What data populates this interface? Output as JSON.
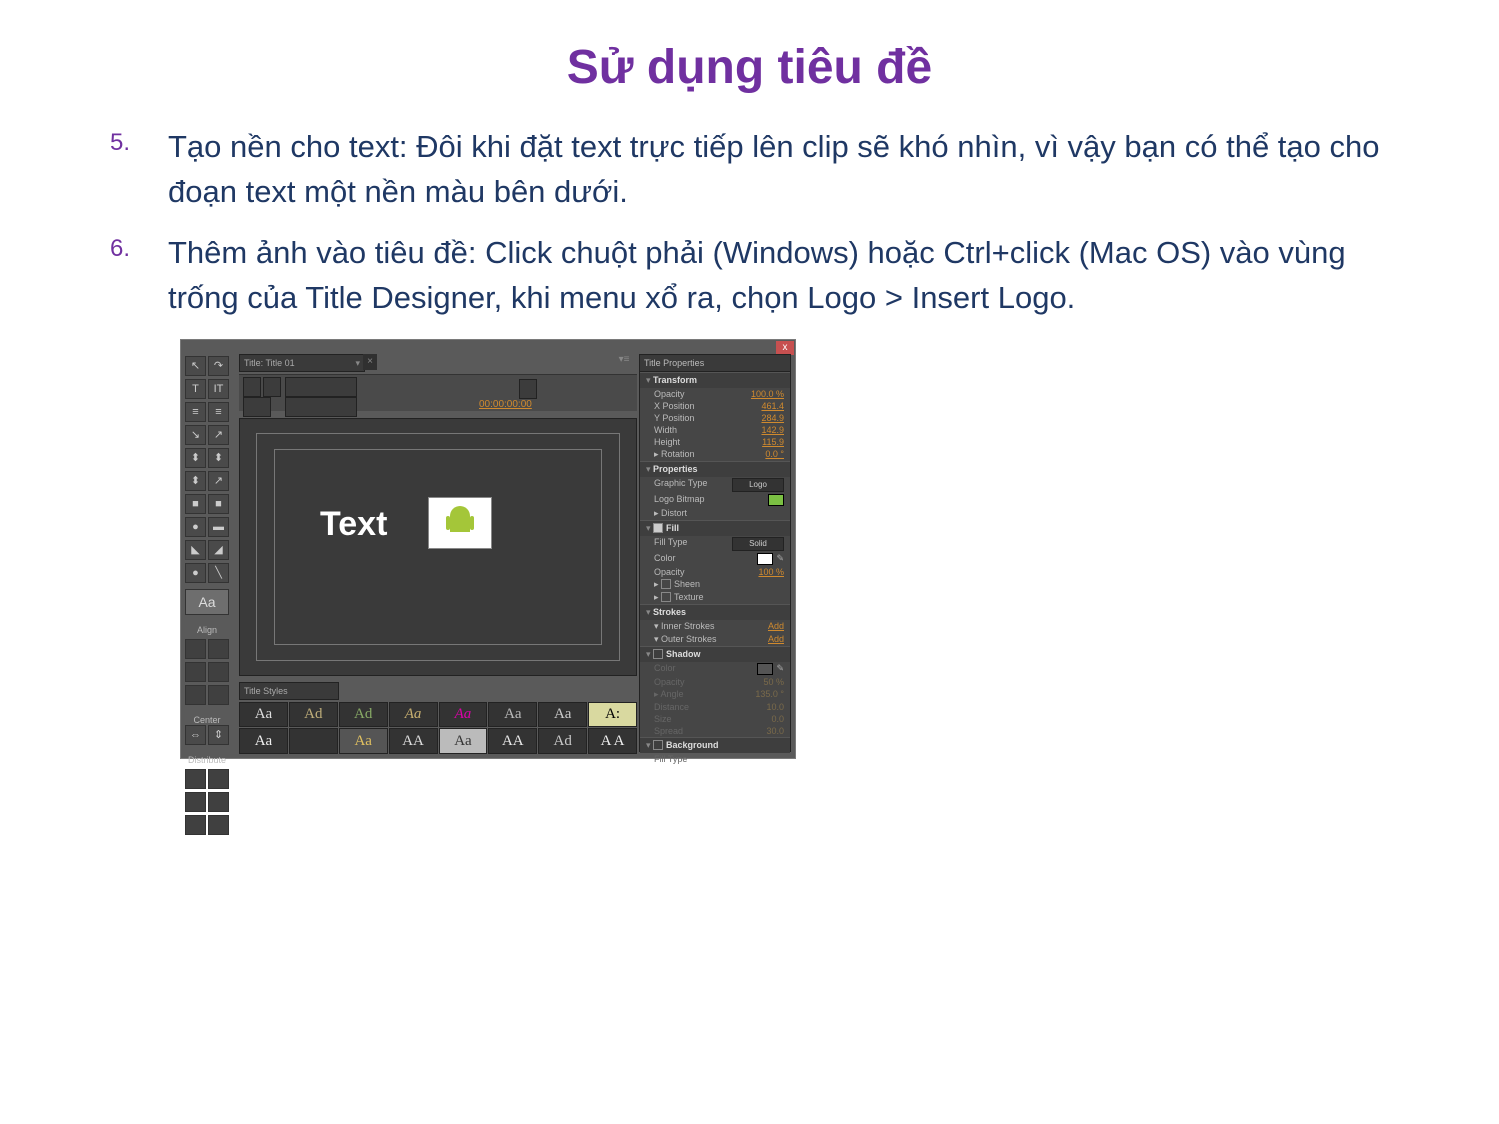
{
  "title": "Sử dụng tiêu đề",
  "items": [
    {
      "num": "5.",
      "text": "Tạo nền cho text: Đôi khi đặt text trực tiếp lên clip sẽ khó nhìn, vì vậy bạn có thể tạo cho đoạn text một nền màu bên dưới."
    },
    {
      "num": "6.",
      "text": "Thêm ảnh vào tiêu đề: Click chuột phải (Windows) hoặc Ctrl+click (Mac OS) vào vùng trống của Title Designer, khi menu xổ ra, chọn Logo > Insert Logo."
    }
  ],
  "editor": {
    "close": "x",
    "tab": "Title: Title 01",
    "timecode": "00:00:00:00",
    "canvas_text": "Text",
    "tools_glyphs": [
      [
        "↖",
        "↷"
      ],
      [
        "T",
        "IT"
      ],
      [
        "≡",
        "≡"
      ],
      [
        "↘",
        "↗"
      ],
      [
        "⬍",
        "⬍"
      ],
      [
        "⬍",
        "↗"
      ],
      [
        "■",
        "■"
      ],
      [
        "●",
        "▬"
      ],
      [
        "◣",
        "◢"
      ],
      [
        "●",
        "╲"
      ]
    ],
    "aa": "Aa",
    "labels": {
      "align": "Align",
      "center": "Center",
      "distribute": "Distribute"
    },
    "center_glyphs": [
      "⇔",
      "⇕"
    ],
    "styles_tab": "Title Styles",
    "style_cells": [
      {
        "t": "Aa",
        "c": "#ddd"
      },
      {
        "t": "Ad",
        "c": "#bfae7a"
      },
      {
        "t": "Ad",
        "c": "#8a6"
      },
      {
        "t": "Aa",
        "c": "#c8b070",
        "i": true
      },
      {
        "t": "Aa",
        "c": "#d0a",
        "i": true
      },
      {
        "t": "Aa",
        "c": "#bbb"
      },
      {
        "t": "Aa",
        "c": "#ccc"
      },
      {
        "t": "A:",
        "c": "#000",
        "bg": "#d9d9a0"
      },
      {
        "t": "Aa",
        "c": "#eee"
      },
      {
        "t": "",
        "c": "#555"
      },
      {
        "t": "Aa",
        "c": "#e0c060",
        "bg": "#555"
      },
      {
        "t": "AA",
        "c": "#ddd"
      },
      {
        "t": "Aa",
        "c": "#333",
        "bg": "#bbb"
      },
      {
        "t": "AA",
        "c": "#e8e8e8"
      },
      {
        "t": "Ad",
        "c": "#c8c8c8"
      },
      {
        "t": "A A",
        "c": "#eee"
      }
    ],
    "props": {
      "tab": "Title Properties",
      "transform": "Transform",
      "opacity_l": "Opacity",
      "opacity_v": "100.0 %",
      "xpos_l": "X Position",
      "xpos_v": "461.4",
      "ypos_l": "Y Position",
      "ypos_v": "284.9",
      "width_l": "Width",
      "width_v": "142.9",
      "height_l": "Height",
      "height_v": "115.9",
      "rot_l": "Rotation",
      "rot_v": "0.0 °",
      "properties": "Properties",
      "gtype_l": "Graphic Type",
      "gtype_v": "Logo",
      "lbitmap_l": "Logo Bitmap",
      "distort": "Distort",
      "fill": "Fill",
      "ftype_l": "Fill Type",
      "ftype_v": "Solid",
      "color_l": "Color",
      "fopacity_l": "Opacity",
      "fopacity_v": "100 %",
      "sheen": "Sheen",
      "texture": "Texture",
      "strokes": "Strokes",
      "inner_l": "Inner Strokes",
      "inner_v": "Add",
      "outer_l": "Outer Strokes",
      "outer_v": "Add",
      "shadow": "Shadow",
      "sh_color": "Color",
      "sh_opacity": "Opacity",
      "sh_opacity_v": "50 %",
      "sh_angle": "Angle",
      "sh_angle_v": "135.0 °",
      "sh_dist": "Distance",
      "sh_dist_v": "10.0",
      "sh_size": "Size",
      "sh_size_v": "0.0",
      "sh_spread": "Spread",
      "sh_spread_v": "30.0",
      "background": "Background",
      "bg_ftype": "Fill Type"
    }
  }
}
